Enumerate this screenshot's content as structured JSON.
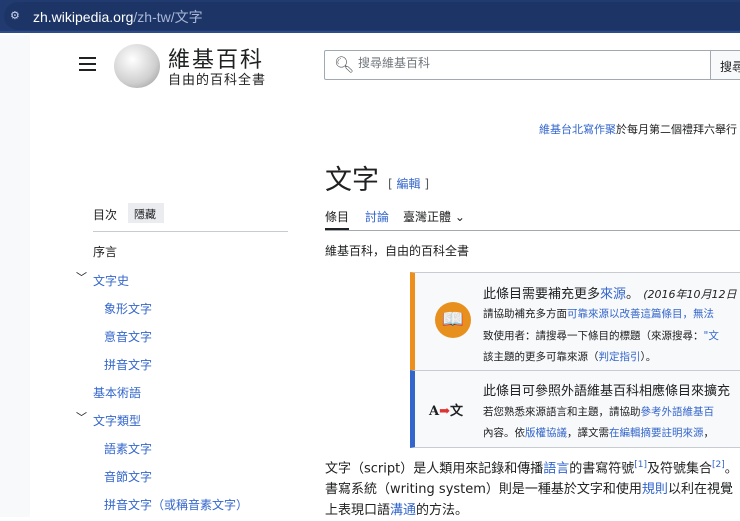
{
  "browser": {
    "url_host": "zh.wikipedia.org",
    "url_path": "/zh-tw/文字",
    "tune_icon": "site-settings-icon"
  },
  "header": {
    "site_name": "維基百科",
    "site_sub": "自由的百科全書",
    "search_placeholder": "搜尋維基百科",
    "search_button": "搜尋"
  },
  "banner": {
    "link": "維基台北寫作聚",
    "text": "於每月第二個禮拜六舉行"
  },
  "article": {
    "title": "文字",
    "edit": "編輯",
    "tabs": [
      "條目",
      "討論",
      "臺灣正體"
    ],
    "tagline": "維基百科，自由的百科全書"
  },
  "notice1": {
    "l1a": "此條目需要補充更多",
    "l1link": "來源",
    "l1b": "。",
    "l1date": "(2016年10月12日",
    "l2a": "請協助補充多方面",
    "l2link": "可靠來源以改善這篇條目，無法",
    "l3a": "致使用者：請搜尋一下條目的標題（來源搜尋：",
    "l3link": "\"文",
    "l4a": "該主題的更多可靠來源（",
    "l4link": "判定指引",
    "l4b": "）。"
  },
  "notice2": {
    "l1": "此條目可參照外語維基百科相應條目來擴充",
    "l2a": "若您熟悉來源語言和主題，請協助",
    "l2link": "參考外語維基百",
    "l3a": "內容。依",
    "l3link": "版權協議",
    "l3b": "，譯文需",
    "l3link2": "在編輯摘要註明來源",
    "l3c": "，",
    "icon_a": "A",
    "icon_b": "文"
  },
  "body": {
    "p1": "文字（script）是人類用來記錄和傳播",
    "link1": "語言",
    "p2": "的書寫符號",
    "ref1": "[1]",
    "p3": "及符號集合",
    "ref2": "[2]",
    "p4": "。書寫系統（writing system）則是一種基於文字和使用",
    "link2": "規則",
    "p5": "以利在視覺上表現口語",
    "link3": "溝通",
    "p6": "的方法。"
  },
  "toc": {
    "heading": "目次",
    "hide": "隱藏",
    "items": [
      "序言",
      "文字史",
      "象形文字",
      "意音文字",
      "拼音文字",
      "基本術語",
      "文字類型",
      "語素文字",
      "音節文字",
      "拼音文字（或稱音素文字）"
    ]
  }
}
